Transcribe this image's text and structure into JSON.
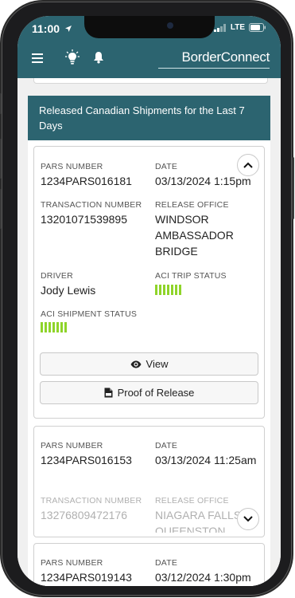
{
  "status_bar": {
    "time": "11:00",
    "network": "LTE"
  },
  "header": {
    "menu_icon": "hamburger-menu-icon",
    "tips_icon": "lightbulb-icon",
    "alerts_icon": "bell-icon",
    "brand": "BorderConnect"
  },
  "section": {
    "title": "Released Canadian Shipments for the Last 7 Days"
  },
  "cards": [
    {
      "pars_label": "PARS NUMBER",
      "pars_number": "1234PARS016181",
      "date_label": "DATE",
      "date": "03/13/2024 1:15pm",
      "transaction_label": "TRANSACTION NUMBER",
      "transaction_number": "13201071539895",
      "office_label": "RELEASE OFFICE",
      "release_office": "WINDSOR AMBASSADOR BRIDGE",
      "driver_label": "DRIVER",
      "driver": "Jody Lewis",
      "trip_status_label": "ACI TRIP STATUS",
      "shipment_status_label": "ACI SHIPMENT STATUS",
      "view_label": "View",
      "proof_label": "Proof of Release"
    },
    {
      "pars_label": "PARS NUMBER",
      "pars_number": "1234PARS016153",
      "date_label": "DATE",
      "date": "03/13/2024 11:25am",
      "transaction_label": "TRANSACTION NUMBER",
      "transaction_number": "13276809472176",
      "office_label": "RELEASE OFFICE",
      "release_office": "NIAGARA FALLS QUEENSTON"
    },
    {
      "pars_label": "PARS NUMBER",
      "pars_number": "1234PARS019143",
      "date_label": "DATE",
      "date": "03/12/2024 1:30pm"
    }
  ],
  "colors": {
    "brand_teal": "#2c6470",
    "status_green": "#8fd42a"
  }
}
